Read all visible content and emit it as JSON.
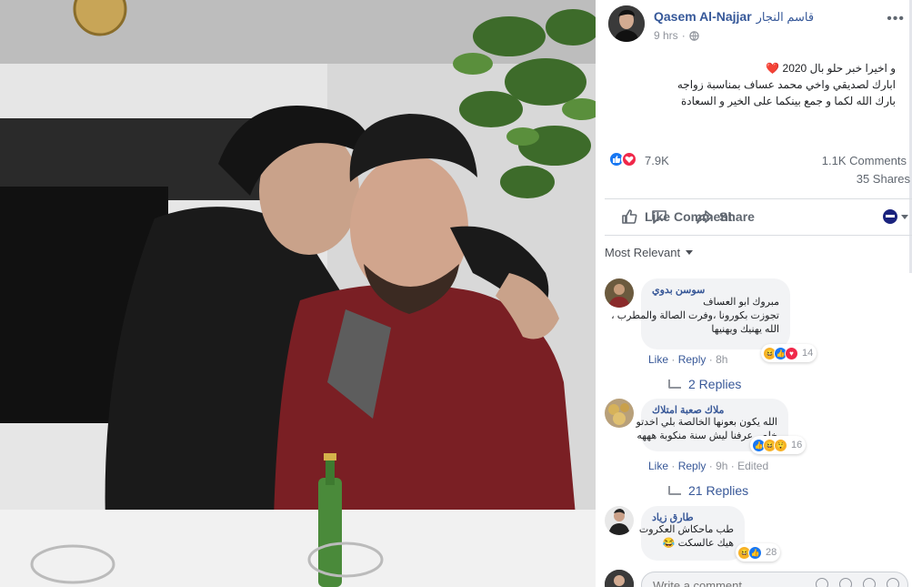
{
  "post": {
    "author_name": "Qasem Al-Najjar",
    "author_name_ar": "قاسم النجار",
    "time": "9 hrs",
    "privacy_icon": "globe-icon",
    "text_lines": [
      "و اخيرا خبر حلو بال 2020 ❤️",
      "ابارك لصديقي واخي محمد عساف بمناسبة زواجه",
      "بارك الله لكما و جمع بينكما على الخير و السعادة"
    ],
    "reaction_count": "7.9K",
    "comments_count": "1.1K Comments",
    "shares_count": "35 Shares"
  },
  "actions": {
    "like": "Like",
    "comment": "Comment",
    "share": "Share"
  },
  "sort_label": "Most Relevant",
  "comments": [
    {
      "name": "سوسن بدوي",
      "lines": [
        "مبروك ابو العساف",
        "تجوزت بكورونا ،وفرت الصالة والمطرب ،",
        "الله يهنيك ويهنيها"
      ],
      "reaction_count": "14",
      "reply_label": "Reply",
      "like_label": "Like",
      "time": "8h",
      "replies": "2 Replies"
    },
    {
      "name": "ملاك صعبة امتلاك",
      "lines": [
        "الله يكون بعونها الخالصة بلي اخدتو",
        "خلص عرفنا ليش سنة منكوبة هههه"
      ],
      "reaction_count": "16",
      "reply_label": "Reply",
      "like_label": "Like",
      "time": "9h",
      "edited": "Edited",
      "replies": "21 Replies"
    },
    {
      "name": "طارق زياد",
      "lines": [
        "طب ماحكاش العكروت",
        "هيك عالسكت 😂"
      ],
      "reaction_count": "28"
    }
  ],
  "write_comment_placeholder": "Write a comment...",
  "colors": {
    "link": "#365899",
    "like_blue": "#1877f2",
    "love_red": "#f0284a",
    "haha_yellow": "#f7b125",
    "bubble_bg": "#f2f3f5"
  }
}
